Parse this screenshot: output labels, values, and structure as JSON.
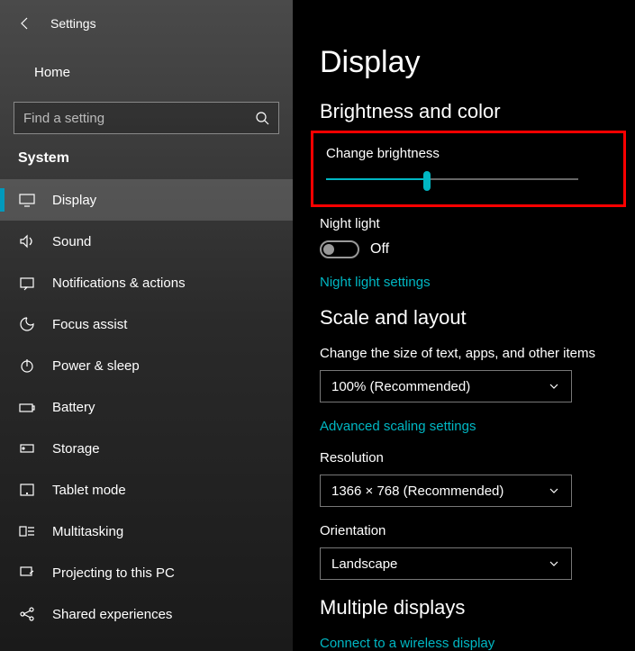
{
  "header": {
    "title": "Settings"
  },
  "home": {
    "label": "Home"
  },
  "search": {
    "placeholder": "Find a setting"
  },
  "category": "System",
  "sidebar": {
    "items": [
      {
        "label": "Display"
      },
      {
        "label": "Sound"
      },
      {
        "label": "Notifications & actions"
      },
      {
        "label": "Focus assist"
      },
      {
        "label": "Power & sleep"
      },
      {
        "label": "Battery"
      },
      {
        "label": "Storage"
      },
      {
        "label": "Tablet mode"
      },
      {
        "label": "Multitasking"
      },
      {
        "label": "Projecting to this PC"
      },
      {
        "label": "Shared experiences"
      }
    ]
  },
  "main": {
    "title": "Display",
    "section1": "Brightness and color",
    "brightness_label": "Change brightness",
    "brightness_value_pct": 40,
    "night_light_label": "Night light",
    "night_light_state": "Off",
    "night_settings_link": "Night light settings",
    "section2": "Scale and layout",
    "scale_label": "Change the size of text, apps, and other items",
    "scale_value": "100% (Recommended)",
    "advanced_scaling_link": "Advanced scaling settings",
    "resolution_label": "Resolution",
    "resolution_value": "1366 × 768 (Recommended)",
    "orientation_label": "Orientation",
    "orientation_value": "Landscape",
    "section3": "Multiple displays",
    "wireless_link": "Connect to a wireless display"
  },
  "colors": {
    "accent": "#00b7c3",
    "highlight": "#ff0000"
  }
}
